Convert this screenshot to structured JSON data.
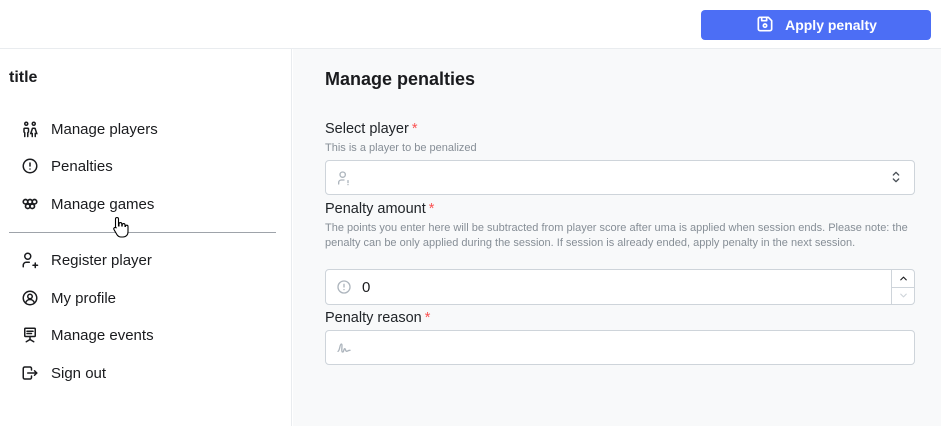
{
  "header": {
    "apply_label": "Apply penalty"
  },
  "sidebar": {
    "title": "title",
    "items": [
      {
        "label": "Manage players",
        "icon": "players-icon"
      },
      {
        "label": "Penalties",
        "icon": "alert-circle-icon"
      },
      {
        "label": "Manage games",
        "icon": "games-icon"
      },
      {
        "label": "Register player",
        "icon": "user-plus-icon"
      },
      {
        "label": "My profile",
        "icon": "user-circle-icon"
      },
      {
        "label": "Manage events",
        "icon": "events-icon"
      },
      {
        "label": "Sign out",
        "icon": "logout-icon"
      }
    ]
  },
  "main": {
    "title": "Manage penalties",
    "select_player": {
      "label": "Select player",
      "required": "*",
      "description": "This is a player to be penalized",
      "value": ""
    },
    "penalty_amount": {
      "label": "Penalty amount",
      "required": "*",
      "description": "The points you enter here will be subtracted from player score after uma is applied when session ends. Please note: the penalty can be only applied during the session. If session is already ended, apply penalty in the next session.",
      "value": "0"
    },
    "penalty_reason": {
      "label": "Penalty reason",
      "required": "*",
      "value": ""
    }
  },
  "colors": {
    "accent": "#4c6ef5",
    "required": "#fa5252",
    "muted": "#868e96"
  }
}
